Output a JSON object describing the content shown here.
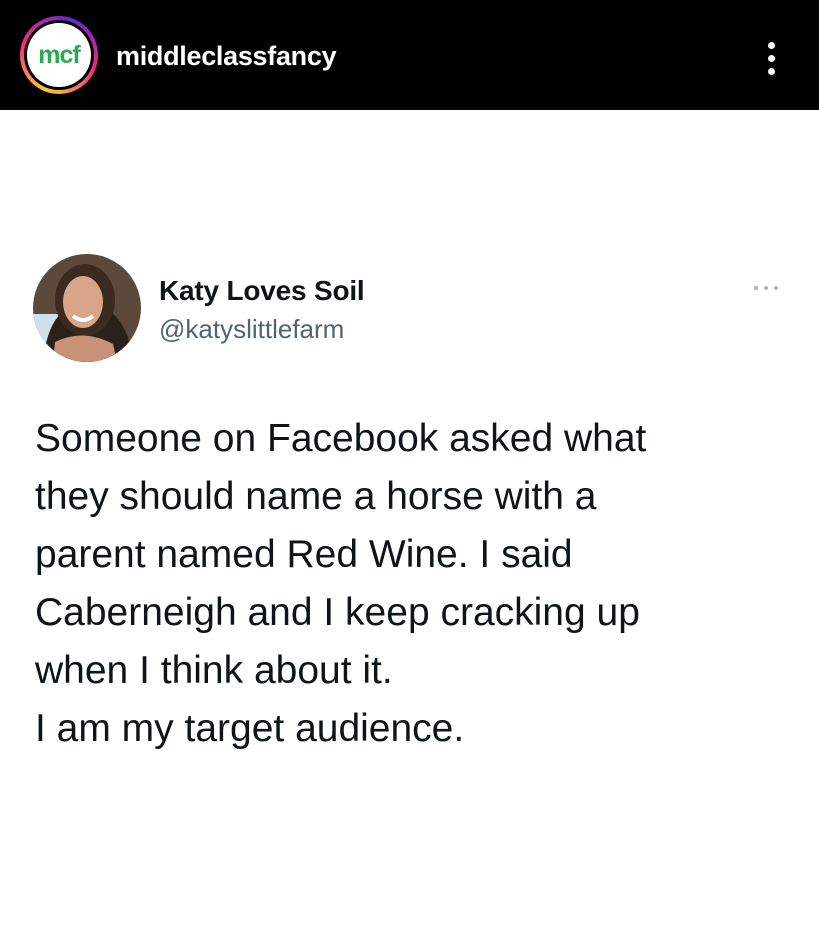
{
  "header": {
    "account_name": "middleclassfancy",
    "logo_text": "mcf",
    "more_icon": "vertical-ellipsis-icon",
    "colors": {
      "bar": "#000000",
      "logo_green": "#2fa84f"
    }
  },
  "tweet": {
    "display_name": "Katy Loves Soil",
    "handle": "@katyslittlefarm",
    "more_icon": "horizontal-ellipsis-icon",
    "lines": [
      "Someone on Facebook asked what",
      "they should name a horse with a",
      "parent named Red Wine. I said",
      "Caberneigh and I keep cracking up",
      "when I think about it.",
      "I am my target audience."
    ],
    "colors": {
      "text": "#0f1419",
      "handle": "#536471"
    }
  }
}
